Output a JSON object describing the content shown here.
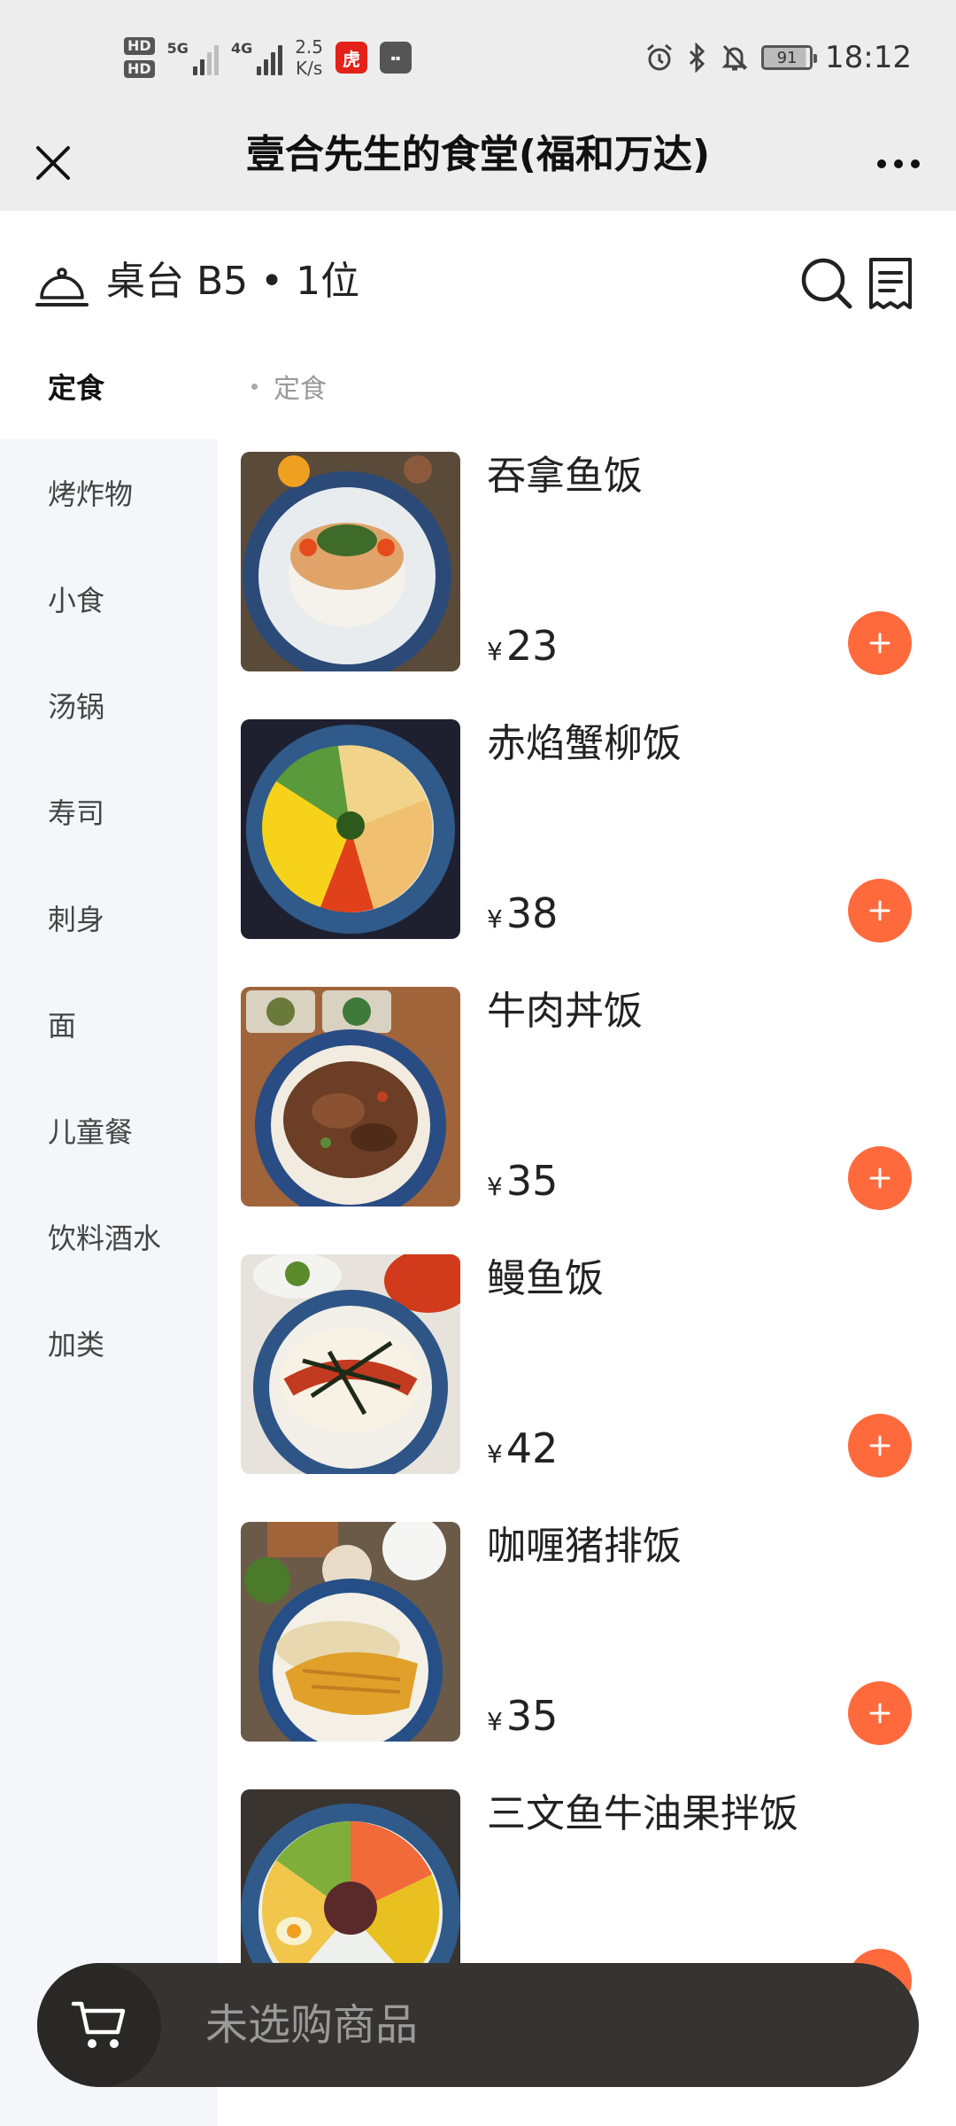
{
  "status_bar": {
    "hd1": "HD",
    "hd2": "HD",
    "net1": "5G",
    "net2": "4G",
    "speed_value": "2.5",
    "speed_unit": "K/s",
    "battery": "91",
    "time": "18:12"
  },
  "header": {
    "title": "壹合先生的食堂(福和万达)"
  },
  "table_info": {
    "label": "桌台 B5 • 1位"
  },
  "sidebar": {
    "categories": [
      {
        "label": "定食",
        "active": true
      },
      {
        "label": "烤炸物"
      },
      {
        "label": "小食"
      },
      {
        "label": "汤锅"
      },
      {
        "label": "寿司"
      },
      {
        "label": "刺身"
      },
      {
        "label": "面"
      },
      {
        "label": "儿童餐"
      },
      {
        "label": "饮料酒水"
      },
      {
        "label": "加类"
      }
    ]
  },
  "menu": {
    "section_title": "定食",
    "currency": "¥",
    "items": [
      {
        "name": "吞拿鱼饭",
        "price": "23"
      },
      {
        "name": "赤焰蟹柳饭",
        "price": "38"
      },
      {
        "name": "牛肉丼饭",
        "price": "35"
      },
      {
        "name": "鳗鱼饭",
        "price": "42"
      },
      {
        "name": "咖喱猪排饭",
        "price": "35"
      },
      {
        "name": "三文鱼牛油果拌饭",
        "price": ""
      }
    ]
  },
  "cart": {
    "empty_text": "未选购商品"
  },
  "colors": {
    "accent": "#ff6a3c",
    "cart_bg": "#363330",
    "sidebar_bg": "#f5f6fa",
    "titlebar_bg": "#ededed"
  }
}
